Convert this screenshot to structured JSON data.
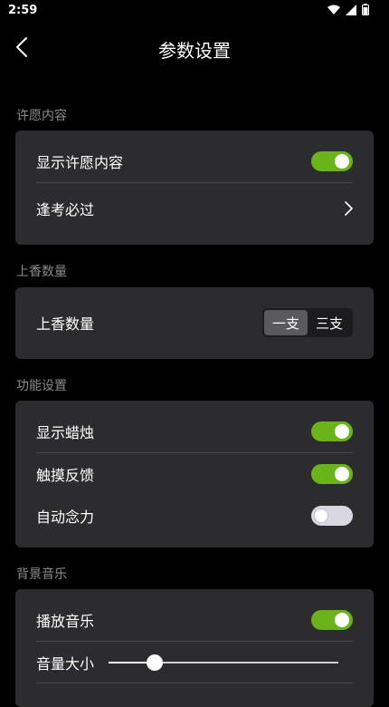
{
  "status_bar": {
    "time": "2:59"
  },
  "header": {
    "title": "参数设置"
  },
  "sections": {
    "wish": {
      "title": "许愿内容",
      "show_label": "显示许愿内容",
      "show_on": true,
      "content_label": "逢考必过"
    },
    "incense": {
      "title": "上香数量",
      "label": "上香数量",
      "options": [
        "一支",
        "三支"
      ],
      "selected": "一支"
    },
    "function": {
      "title": "功能设置",
      "items": [
        {
          "label": "显示蜡烛",
          "on": true
        },
        {
          "label": "触摸反馈",
          "on": true
        },
        {
          "label": "自动念力",
          "on": false
        }
      ]
    },
    "music": {
      "title": "背景音乐",
      "play_label": "播放音乐",
      "play_on": true,
      "volume_label": "音量大小",
      "volume_fraction": 0.2
    }
  },
  "colors": {
    "accent": "#6bb31b",
    "card": "#2c2c2e",
    "background": "#000000"
  }
}
